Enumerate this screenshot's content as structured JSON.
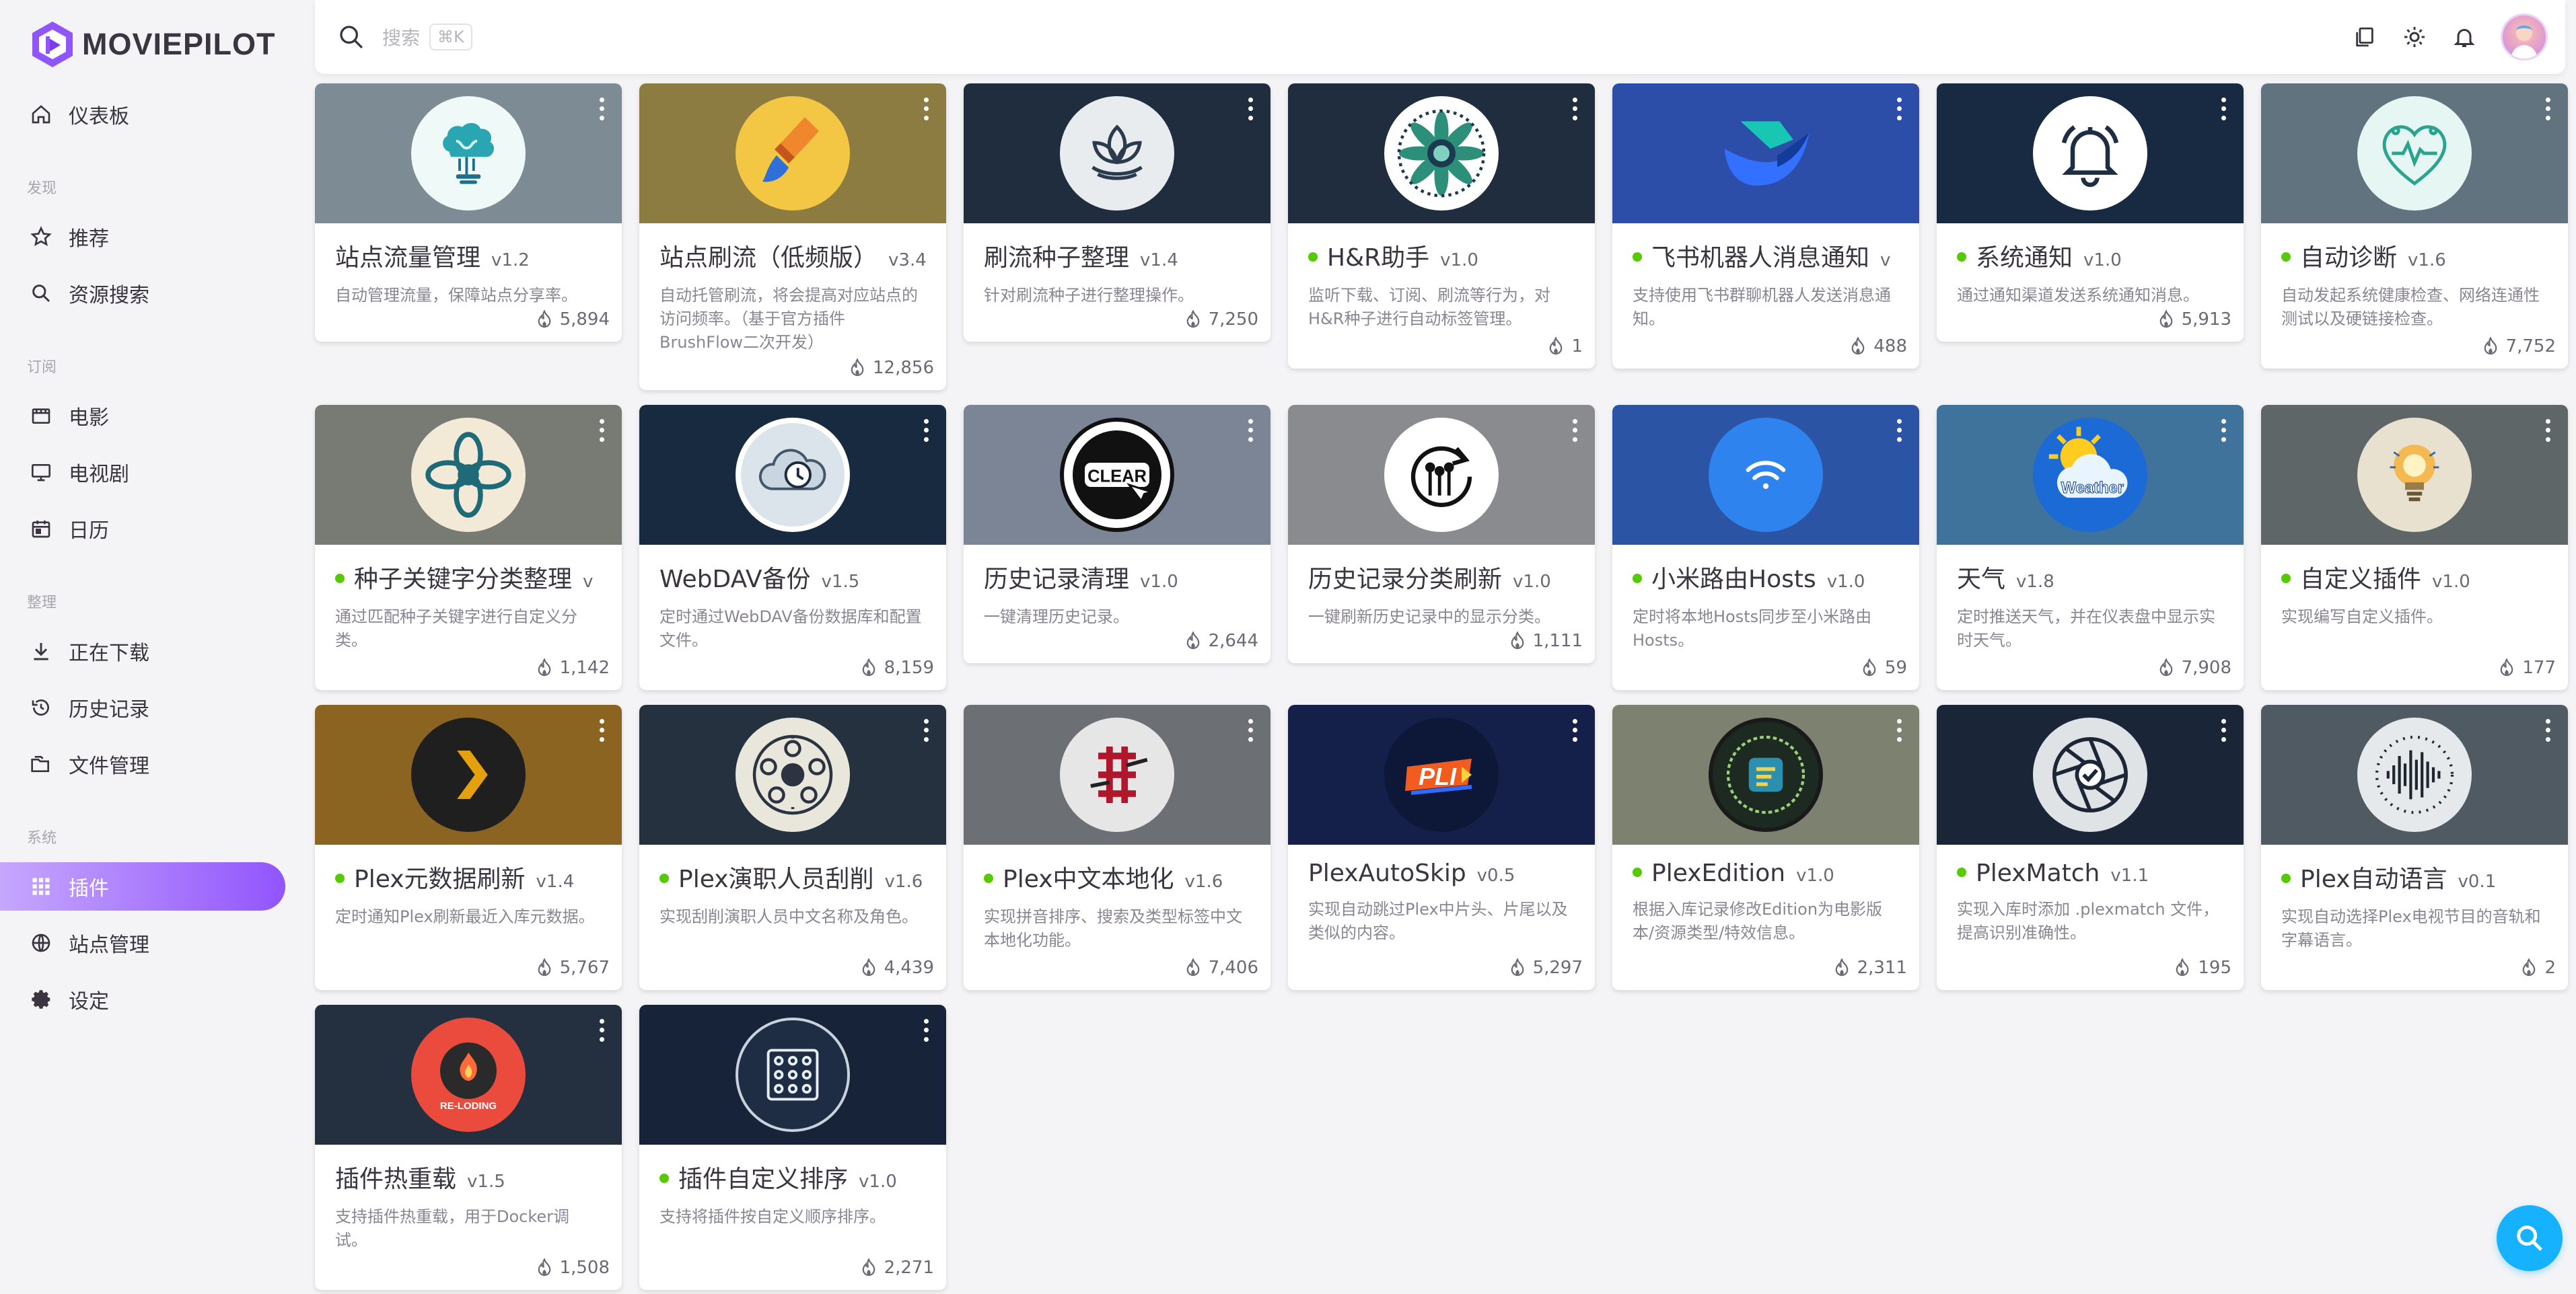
{
  "app": {
    "name": "MOVIEPILOT"
  },
  "search": {
    "placeholder": "搜索",
    "shortcut": "⌘K"
  },
  "nav": {
    "dashboard": "仪表板",
    "section_discover": "发现",
    "recommend": "推荐",
    "resource_search": "资源搜索",
    "section_subscribe": "订阅",
    "movies": "电影",
    "tv": "电视剧",
    "calendar": "日历",
    "section_organize": "整理",
    "downloading": "正在下载",
    "history": "历史记录",
    "file_manager": "文件管理",
    "section_system": "系统",
    "plugins": "插件",
    "site_management": "站点管理",
    "settings": "设定"
  },
  "plugins": [
    {
      "title": "站点流量管理",
      "version": "v1.2",
      "desc": "自动管理流量，保障站点分享率。",
      "count": "5,894",
      "running": false,
      "bg": "#7d8b94",
      "icon": "brain-circuit"
    },
    {
      "title": "站点刷流（低频版）",
      "version": "v3.4",
      "desc": "自动托管刷流，将会提高对应站点的访问频率。（基于官方插件BrushFlow二次开发）",
      "count": "12,856",
      "running": false,
      "bg": "#8d7c42",
      "icon": "paintbrush"
    },
    {
      "title": "刷流种子整理",
      "version": "v1.4",
      "desc": "针对刷流种子进行整理操作。",
      "count": "7,250",
      "running": false,
      "bg": "#1f2d3e",
      "icon": "lotus"
    },
    {
      "title": "H&R助手",
      "version": "v1.0",
      "desc": "监听下载、订阅、刷流等行为，对H&R种子进行自动标签管理。",
      "count": "1",
      "running": true,
      "bg": "#1f2d3e",
      "icon": "mandala"
    },
    {
      "title": "飞书机器人消息通知",
      "version": "v",
      "desc": "支持使用飞书群聊机器人发送消息通知。",
      "count": "488",
      "running": true,
      "bg": "#2d4ea8",
      "icon": "feishu"
    },
    {
      "title": "系统通知",
      "version": "v1.0",
      "desc": "通过通知渠道发送系统通知消息。",
      "count": "5,913",
      "running": true,
      "bg": "#172a42",
      "icon": "bell"
    },
    {
      "title": "自动诊断",
      "version": "v1.6",
      "desc": "自动发起系统健康检查、网络连通性测试以及硬链接检查。",
      "count": "7,752",
      "running": true,
      "bg": "#627380",
      "icon": "heart-circuit"
    },
    {
      "title": "种子关键字分类整理",
      "version": "v",
      "desc": "通过匹配种子关键字进行自定义分类。",
      "count": "1,142",
      "running": true,
      "bg": "#787b74",
      "icon": "knot"
    },
    {
      "title": "WebDAV备份",
      "version": "v1.5",
      "desc": "定时通过WebDAV备份数据库和配置文件。",
      "count": "8,159",
      "running": false,
      "bg": "#182a40",
      "icon": "cloud-clock"
    },
    {
      "title": "历史记录清理",
      "version": "v1.0",
      "desc": "一键清理历史记录。",
      "count": "2,644",
      "running": false,
      "bg": "#7b8596",
      "icon": "clear"
    },
    {
      "title": "历史记录分类刷新",
      "version": "v1.0",
      "desc": "一键刷新历史记录中的显示分类。",
      "count": "1,111",
      "running": false,
      "bg": "#8a8b8f",
      "icon": "refresh-circuit"
    },
    {
      "title": "小米路由Hosts",
      "version": "v1.0",
      "desc": "定时将本地Hosts同步至小米路由Hosts。",
      "count": "59",
      "running": true,
      "bg": "#2b54a4",
      "icon": "wifi"
    },
    {
      "title": "天气",
      "version": "v1.8",
      "desc": "定时推送天气，并在仪表盘中显示实时天气。",
      "count": "7,908",
      "running": false,
      "bg": "#3f739c",
      "icon": "weather"
    },
    {
      "title": "自定义插件",
      "version": "v1.0",
      "desc": "实现编写自定义插件。",
      "count": "177",
      "running": true,
      "bg": "#5f6668",
      "icon": "bulb"
    },
    {
      "title": "Plex元数据刷新",
      "version": "v1.4",
      "desc": "定时通知Plex刷新最近入库元数据。",
      "count": "5,767",
      "running": true,
      "bg": "#8a6420",
      "icon": "plex-chevron"
    },
    {
      "title": "Plex演职人员刮削",
      "version": "v1.6",
      "desc": "实现刮削演职人员中文名称及角色。",
      "count": "4,439",
      "running": true,
      "bg": "#25313f",
      "icon": "film-reel"
    },
    {
      "title": "Plex中文本地化",
      "version": "v1.6",
      "desc": "实现拼音排序、搜索及类型标签中文本地化功能。",
      "count": "7,406",
      "running": true,
      "bg": "#6c6f74",
      "icon": "chinese"
    },
    {
      "title": "PlexAutoSkip",
      "version": "v0.5",
      "desc": "实现自动跳过Plex中片头、片尾以及类似的内容。",
      "count": "5,297",
      "running": false,
      "bg": "#14204a",
      "icon": "pli"
    },
    {
      "title": "PlexEdition",
      "version": "v1.0",
      "desc": "根据入库记录修改Edition为电影版本/资源类型/特效信息。",
      "count": "2,311",
      "running": true,
      "bg": "#7c826f",
      "icon": "edition"
    },
    {
      "title": "PlexMatch",
      "version": "v1.1",
      "desc": "实现入库时添加 .plexmatch 文件，提高识别准确性。",
      "count": "195",
      "running": true,
      "bg": "#1a2638",
      "icon": "aperture"
    },
    {
      "title": "Plex自动语言",
      "version": "v0.1",
      "desc": "实现自动选择Plex电视节目的音轨和字幕语言。",
      "count": "2",
      "running": true,
      "bg": "#4f5a63",
      "icon": "soundwave"
    },
    {
      "title": "插件热重载",
      "version": "v1.5",
      "desc": "支持插件热重载，用于Docker调试。",
      "count": "1,508",
      "running": false,
      "bg": "#243040",
      "icon": "reload"
    },
    {
      "title": "插件自定义排序",
      "version": "v1.0",
      "desc": "支持将插件按自定义顺序排序。",
      "count": "2,271",
      "running": true,
      "bg": "#172338",
      "icon": "grid-sort"
    }
  ],
  "logo_text": {
    "clear": "CLEAR",
    "weather": "Weather",
    "pli": "PLI",
    "reload": "RE-LODING"
  },
  "colors": {
    "accent": "#9155fd",
    "running": "#56ca00",
    "fab": "#16b1ff"
  }
}
